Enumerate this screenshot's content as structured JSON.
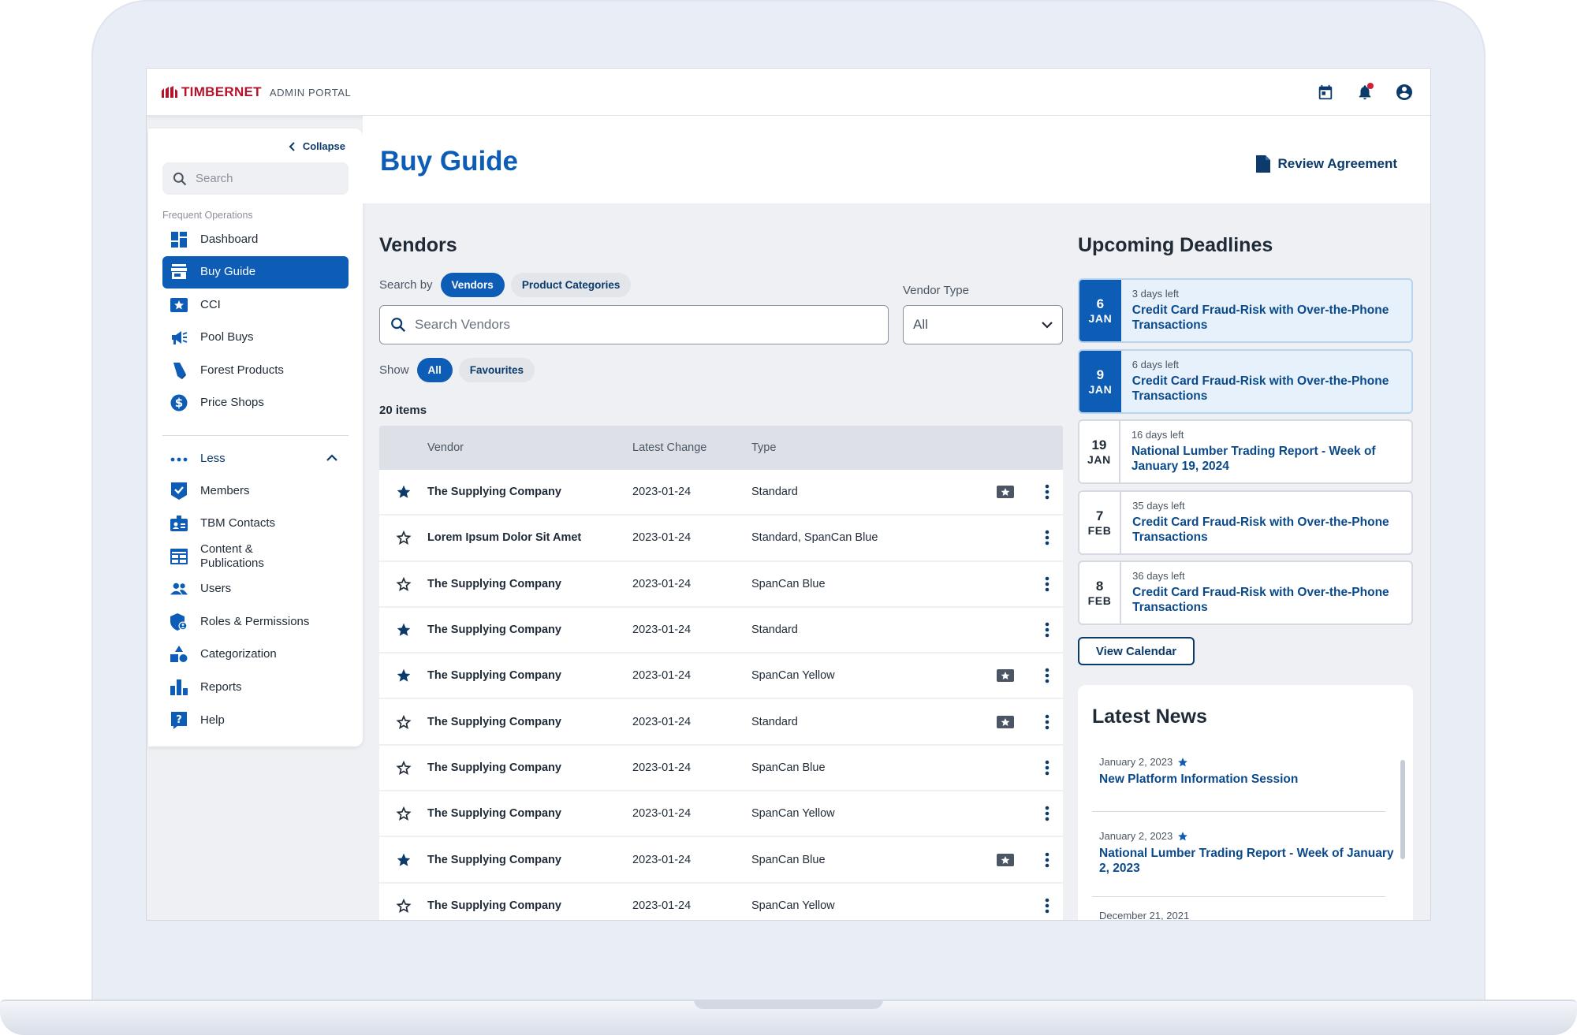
{
  "app": {
    "brand": "TIMBERNET",
    "portal": "ADMIN PORTAL",
    "top_icons": [
      "calendar-icon",
      "bell-icon",
      "account-icon"
    ]
  },
  "sidebar": {
    "collapse_label": "Collapse",
    "search_placeholder": "Search",
    "section_label": "Frequent Operations",
    "frequent": [
      {
        "label": "Dashboard",
        "icon": "dashboard-icon"
      },
      {
        "label": "Buy Guide",
        "icon": "store-icon",
        "active": true
      },
      {
        "label": "CCI",
        "icon": "card-star-icon"
      },
      {
        "label": "Pool Buys",
        "icon": "megaphone-icon"
      },
      {
        "label": "Forest Products",
        "icon": "wood-icon"
      },
      {
        "label": "Price Shops",
        "icon": "dollar-icon"
      }
    ],
    "less_label": "Less",
    "more": [
      {
        "label": "Members",
        "icon": "check-badge-icon"
      },
      {
        "label": "TBM Contacts",
        "icon": "contacts-icon"
      },
      {
        "label": "Content & Publications",
        "icon": "publications-icon"
      },
      {
        "label": "Users",
        "icon": "users-icon"
      },
      {
        "label": "Roles & Permissions",
        "icon": "shield-user-icon"
      },
      {
        "label": "Categorization",
        "icon": "shapes-icon"
      },
      {
        "label": "Reports",
        "icon": "bar-chart-icon"
      },
      {
        "label": "Help",
        "icon": "help-icon"
      }
    ]
  },
  "header": {
    "title": "Buy Guide",
    "review_label": "Review Agreement"
  },
  "vendors": {
    "title": "Vendors",
    "search_by_label": "Search by",
    "search_by_options": [
      "Vendors",
      "Product Categories"
    ],
    "search_placeholder": "Search Vendors",
    "vendor_type_label": "Vendor Type",
    "vendor_type_value": "All",
    "show_label": "Show",
    "show_options": [
      "All",
      "Favourites"
    ],
    "items_count": "20 items",
    "columns": [
      "Vendor",
      "Latest Change",
      "Type"
    ],
    "rows": [
      {
        "fav": true,
        "vendor": "The Supplying Company",
        "date": "2023-01-24",
        "type": "Standard",
        "badge": true
      },
      {
        "fav": false,
        "vendor": "Lorem Ipsum Dolor Sit Amet",
        "date": "2023-01-24",
        "type": "Standard, SpanCan Blue",
        "badge": false
      },
      {
        "fav": false,
        "vendor": "The Supplying Company",
        "date": "2023-01-24",
        "type": "SpanCan Blue",
        "badge": false
      },
      {
        "fav": true,
        "vendor": "The Supplying Company",
        "date": "2023-01-24",
        "type": "Standard",
        "badge": false
      },
      {
        "fav": true,
        "vendor": "The Supplying Company",
        "date": "2023-01-24",
        "type": "SpanCan Yellow",
        "badge": true
      },
      {
        "fav": false,
        "vendor": "The Supplying Company",
        "date": "2023-01-24",
        "type": "Standard",
        "badge": true
      },
      {
        "fav": false,
        "vendor": "The Supplying Company",
        "date": "2023-01-24",
        "type": "SpanCan Blue",
        "badge": false
      },
      {
        "fav": false,
        "vendor": "The Supplying Company",
        "date": "2023-01-24",
        "type": "SpanCan Yellow",
        "badge": false
      },
      {
        "fav": true,
        "vendor": "The Supplying Company",
        "date": "2023-01-24",
        "type": "SpanCan Blue",
        "badge": true
      },
      {
        "fav": false,
        "vendor": "The Supplying Company",
        "date": "2023-01-24",
        "type": "SpanCan Yellow",
        "badge": false
      }
    ]
  },
  "deadlines": {
    "title": "Upcoming Deadlines",
    "items": [
      {
        "day": "6",
        "month": "JAN",
        "left": "3 days left",
        "title": "Credit Card Fraud-Risk with Over-the-Phone Transactions",
        "highlight": true
      },
      {
        "day": "9",
        "month": "JAN",
        "left": "6 days left",
        "title": "Credit Card Fraud-Risk with Over-the-Phone Transactions",
        "highlight": true
      },
      {
        "day": "19",
        "month": "JAN",
        "left": "16 days left",
        "title": "National Lumber Trading Report - Week of January 19, 2024",
        "highlight": false
      },
      {
        "day": "7",
        "month": "FEB",
        "left": "35 days left",
        "title": "Credit Card Fraud-Risk with Over-the-Phone Transactions",
        "highlight": false
      },
      {
        "day": "8",
        "month": "FEB",
        "left": "36 days left",
        "title": "Credit Card Fraud-Risk with Over-the-Phone Transactions",
        "highlight": false
      }
    ],
    "view_calendar_label": "View Calendar"
  },
  "news": {
    "title": "Latest News",
    "items": [
      {
        "date": "January 2, 2023",
        "starred": true,
        "title": "New Platform Information Session"
      },
      {
        "date": "January 2, 2023",
        "starred": true,
        "title": "National Lumber Trading Report - Week of January 2, 2023"
      },
      {
        "date": "December 21, 2021",
        "starred": false,
        "title": ""
      }
    ]
  },
  "colors": {
    "brand_red": "#b3142b",
    "primary_blue": "#0d5cb6",
    "navy": "#0b3a6b",
    "highlight_bg": "#e6f1fb"
  }
}
